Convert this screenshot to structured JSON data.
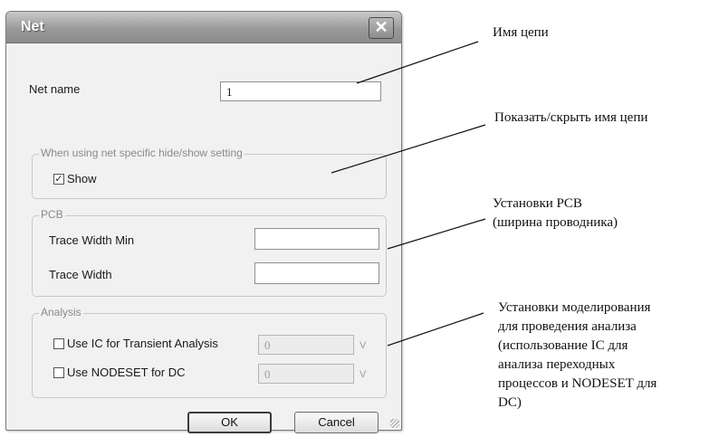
{
  "dialog": {
    "title": "Net",
    "close_glyph": "✕",
    "net_name_label": "Net name",
    "net_name_value": "1",
    "hide_show_group": {
      "legend": "When using net specific hide/show setting",
      "show_label": "Show",
      "show_checked": true,
      "check_glyph": "✓"
    },
    "pcb_group": {
      "legend": "PCB",
      "trace_width_min_label": "Trace Width Min",
      "trace_width_min_value": "",
      "trace_width_label": "Trace Width",
      "trace_width_value": ""
    },
    "analysis_group": {
      "legend": "Analysis",
      "ic_label": "Use IC for Transient Analysis",
      "ic_checked": false,
      "ic_value": "0",
      "ic_unit": "V",
      "nodeset_label": "Use NODESET for DC",
      "nodeset_checked": false,
      "nodeset_value": "0",
      "nodeset_unit": "V"
    },
    "ok_label": "OK",
    "cancel_label": "Cancel"
  },
  "annotations": {
    "net_name": "Имя цепи",
    "show_hide": "Показать/скрыть имя цепи",
    "pcb_line1": "Установки PCB",
    "pcb_line2": "(ширина проводника)",
    "analysis_line1": "Установки моделирования",
    "analysis_line2": "для проведения анализа",
    "analysis_line3": "(использование IC для",
    "analysis_line4": "анализа переходных",
    "analysis_line5": "процессов и NODESET для",
    "analysis_line6": "DC)"
  }
}
